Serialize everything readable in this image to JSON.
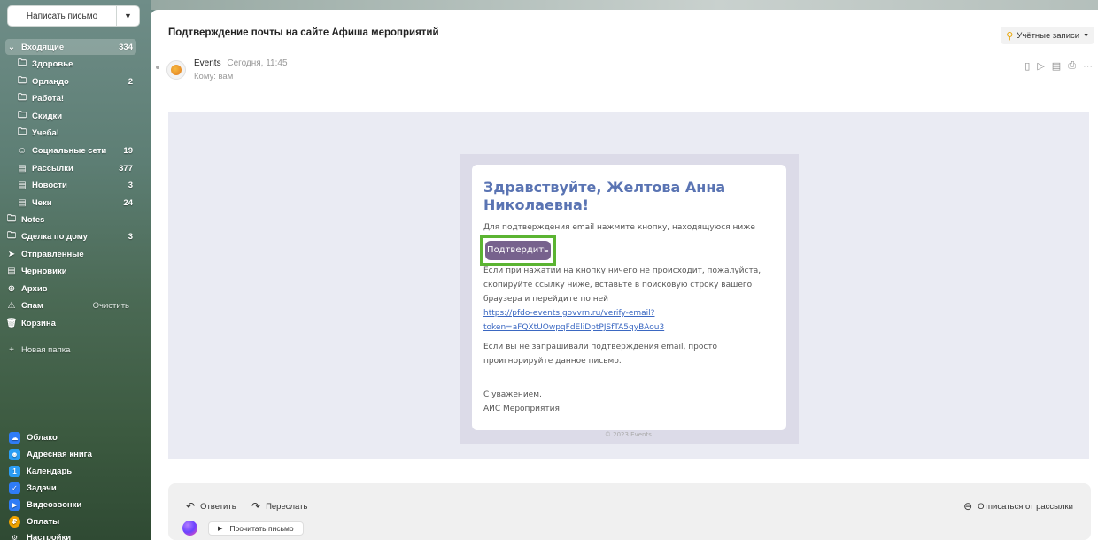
{
  "sidebar": {
    "compose_label": "Написать письмо",
    "folders": [
      {
        "label": "Входящие",
        "count": "334",
        "icon": "chevron-down-icon"
      },
      {
        "label": "Здоровье",
        "count": "",
        "icon": "folder-icon"
      },
      {
        "label": "Орландо",
        "count": "2",
        "icon": "folder-icon"
      },
      {
        "label": "Работа!",
        "count": "",
        "icon": "folder-icon"
      },
      {
        "label": "Скидки",
        "count": "",
        "icon": "folder-icon"
      },
      {
        "label": "Учеба!",
        "count": "",
        "icon": "folder-icon"
      },
      {
        "label": "Социальные сети",
        "count": "19",
        "icon": "social-icon"
      },
      {
        "label": "Рассылки",
        "count": "377",
        "icon": "newsletter-icon"
      },
      {
        "label": "Новости",
        "count": "3",
        "icon": "news-icon"
      },
      {
        "label": "Чеки",
        "count": "24",
        "icon": "receipt-icon"
      },
      {
        "label": "Notes",
        "count": "",
        "icon": "folder-icon"
      },
      {
        "label": "Сделка по дому",
        "count": "3",
        "icon": "folder-icon"
      },
      {
        "label": "Отправленные",
        "count": "",
        "icon": "sent-icon"
      },
      {
        "label": "Черновики",
        "count": "",
        "icon": "drafts-icon"
      },
      {
        "label": "Архив",
        "count": "",
        "icon": "archive-icon"
      },
      {
        "label": "Спам",
        "count": "",
        "icon": "spam-icon"
      },
      {
        "label": "Корзина",
        "count": "",
        "icon": "trash-icon"
      }
    ],
    "spam_clear_label": "Очистить",
    "new_folder_label": "Новая папка",
    "apps": [
      {
        "label": "Облако",
        "color": "#2f7cf6",
        "icon": "cloud-icon"
      },
      {
        "label": "Адресная книга",
        "color": "#2a9df4",
        "icon": "contacts-icon"
      },
      {
        "label": "Календарь",
        "color": "#2a9df4",
        "icon": "calendar-icon"
      },
      {
        "label": "Задачи",
        "color": "#2f7cf6",
        "icon": "tasks-icon"
      },
      {
        "label": "Видеозвонки",
        "color": "#2f7cf6",
        "icon": "video-icon"
      },
      {
        "label": "Оплаты",
        "color": "#f0a300",
        "icon": "payments-icon"
      },
      {
        "label": "Настройки",
        "color": "#444444",
        "icon": "settings-icon"
      }
    ]
  },
  "message": {
    "subject": "Подтверждение почты на сайте Афиша мероприятий",
    "accounts_label": "Учётные записи",
    "sender_name": "Events",
    "sent_time": "Сегодня, 11:45",
    "recipient": "Кому: вам"
  },
  "email": {
    "greeting": "Здравствуйте, Желтова Анна Николаевна!",
    "intro": "Для подтверждения email нажмите кнопку, находящуюся ниже",
    "confirm_label": "Подтвердить",
    "fallback_text": "Если при нажатии на кнопку ничего не происходит, пожалуйста, скопируйте ссылку ниже, вставьте в поисковую строку вашего браузера и перейдите по ней",
    "link_line1": "https://pfdo-events.govvrn.ru/verify-email?",
    "link_line2": "token=aFQXtUOwpqFdEliDptPJSfTA5qyBAou3",
    "ignore_text": "Если вы не запрашивали подтверждения email, просто проигнорируйте данное письмо.",
    "regards": "С уважением,",
    "signature": "АИС Мероприятия",
    "copyright": "© 2023 Events."
  },
  "footer": {
    "reply_label": "Ответить",
    "forward_label": "Переслать",
    "unsubscribe_label": "Отписаться от рассылки",
    "read_aloud_label": "Прочитать письмо"
  },
  "colors": {
    "accent_link": "#3b68c2",
    "greeting": "#5a74b3",
    "confirm_button": "#77628d",
    "highlight_outline": "#5bb432"
  }
}
